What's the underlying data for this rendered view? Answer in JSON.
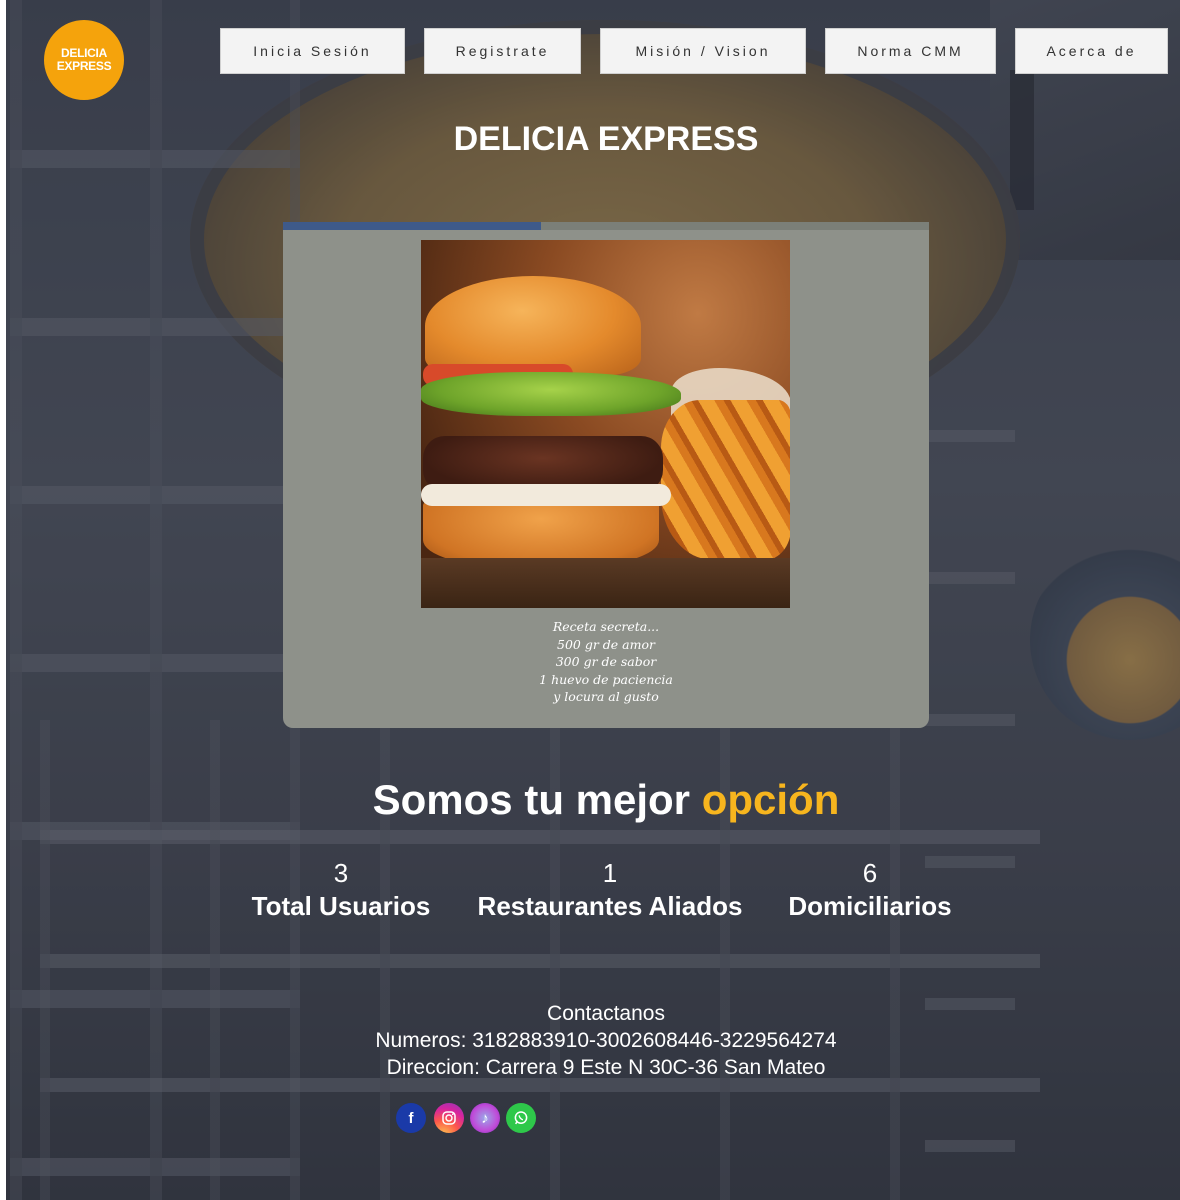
{
  "brand": {
    "logo_line1": "DELICIA",
    "logo_line2": "EXPRESS",
    "logo_color": "#f5a30c",
    "site_title": "DELICIA EXPRESS"
  },
  "nav": {
    "items": [
      {
        "label": "Inicia Sesión"
      },
      {
        "label": "Registrate"
      },
      {
        "label": "Misión / Vision"
      },
      {
        "label": "Norma CMM"
      },
      {
        "label": "Acerca de"
      }
    ]
  },
  "carousel": {
    "progress_fraction": 0.4,
    "progress_color": "#3e5a8a",
    "image_icon": "burger-image",
    "recipe_lines": [
      "Receta secreta...",
      "500 gr de amor",
      "300 gr de sabor",
      "1 huevo de paciencia",
      "y locura al gusto"
    ]
  },
  "slogan": {
    "text": "Somos tu mejor ",
    "accent": "opción",
    "accent_color": "#f7b51e"
  },
  "stats": [
    {
      "value": "3",
      "label": "Total Usuarios"
    },
    {
      "value": "1",
      "label": "Restaurantes Aliados"
    },
    {
      "value": "6",
      "label": "Domiciliarios"
    }
  ],
  "contact": {
    "heading": "Contactanos",
    "phones": "Numeros: 3182883910-3002608446-3229564274",
    "address": "Direccion: Carrera 9 Este N 30C-36 San Mateo"
  },
  "socials": [
    {
      "icon": "facebook-icon",
      "glyph": "f"
    },
    {
      "icon": "instagram-icon",
      "glyph": ""
    },
    {
      "icon": "tiktok-icon",
      "glyph": "♪"
    },
    {
      "icon": "whatsapp-icon",
      "glyph": ""
    }
  ]
}
